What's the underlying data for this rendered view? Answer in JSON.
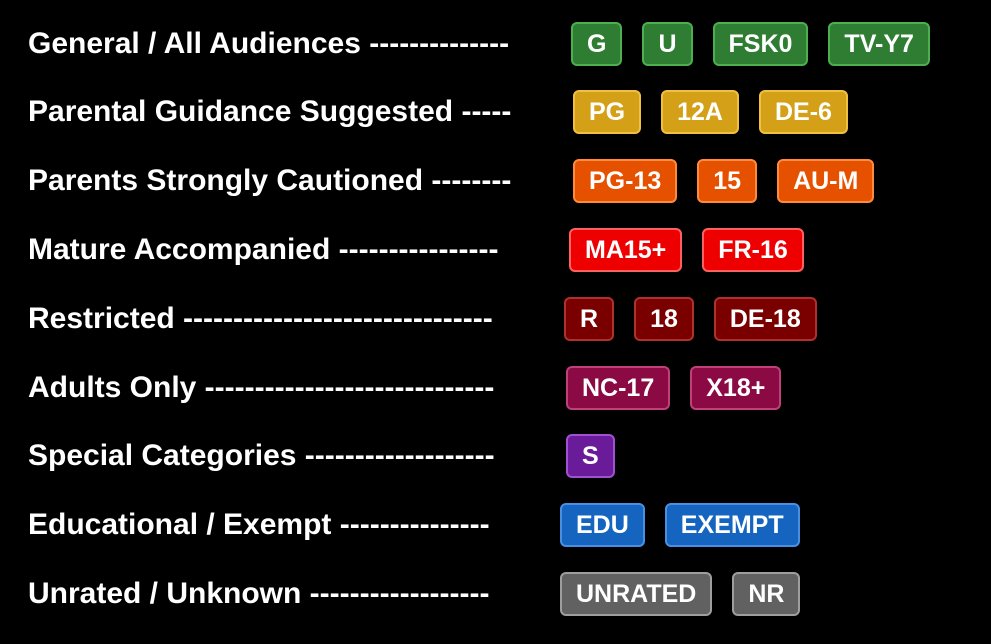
{
  "rows": [
    {
      "label": "General / All Audiences --------------",
      "color": "#2e7d32",
      "border": "#4caf50",
      "badges": [
        "G",
        "U",
        "FSK0",
        "TV-Y7"
      ]
    },
    {
      "label": "Parental Guidance Suggested -----",
      "color": "#d4a017",
      "border": "#f0c040",
      "badges": [
        "PG",
        "12A",
        "DE-6"
      ]
    },
    {
      "label": "Parents Strongly Cautioned --------",
      "color": "#e65100",
      "border": "#ff8a3d",
      "badges": [
        "PG-13",
        "15",
        "AU-M"
      ]
    },
    {
      "label": "Mature Accompanied ----------------",
      "color": "#ee0000",
      "border": "#ff6060",
      "badges": [
        "MA15+",
        "FR-16"
      ]
    },
    {
      "label": "Restricted -------------------------------",
      "color": "#7a0000",
      "border": "#b03030",
      "badges": [
        "R",
        "18",
        "DE-18"
      ]
    },
    {
      "label": "Adults Only -----------------------------",
      "color": "#8b0a44",
      "border": "#c0407a",
      "badges": [
        "NC-17",
        "X18+"
      ]
    },
    {
      "label": "Special Categories -------------------",
      "color": "#6a1b9a",
      "border": "#a050d0",
      "badges": [
        "S"
      ]
    },
    {
      "label": "Educational / Exempt ---------------",
      "color": "#1565c0",
      "border": "#4a90e2",
      "badges": [
        "EDU",
        "EXEMPT"
      ]
    },
    {
      "label": "Unrated / Unknown ------------------",
      "color": "#616161",
      "border": "#9e9e9e",
      "badges": [
        "UNRATED",
        "NR"
      ]
    }
  ]
}
